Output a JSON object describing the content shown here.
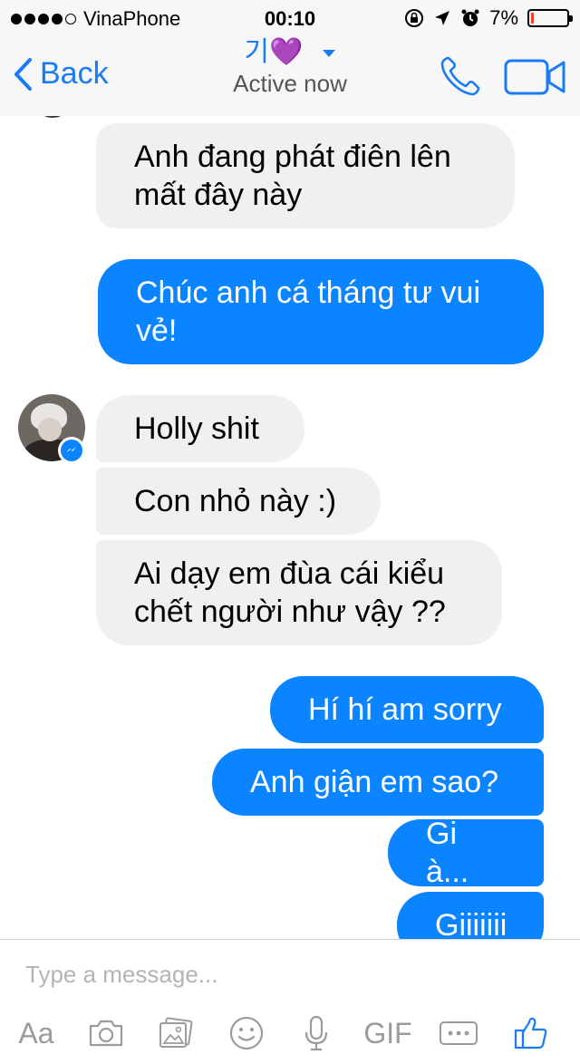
{
  "status_bar": {
    "carrier": "VinaPhone",
    "time": "00:10",
    "battery_text": "7%",
    "battery_level": 0.07,
    "battery_color": "#ff3b30"
  },
  "header": {
    "back_label": "Back",
    "contact_name": "기💜",
    "presence": "Active now",
    "accent": "#1a7cf5"
  },
  "messages": [
    {
      "side": "in",
      "text_lines": [
        "Anh đang phát điên lên",
        "mất đây này"
      ]
    },
    {
      "side": "out",
      "text_lines": [
        "Chúc anh cá tháng tư vui",
        "vẻ!"
      ]
    },
    {
      "side": "in",
      "text_lines": [
        "Holly shit"
      ]
    },
    {
      "side": "in",
      "text_lines": [
        "Con nhỏ này :)"
      ]
    },
    {
      "side": "in",
      "text_lines": [
        "Ai dạy em đùa cái kiểu",
        "chết người như vậy ??"
      ]
    },
    {
      "side": "out",
      "text_lines": [
        "Hí hí am sorry"
      ]
    },
    {
      "side": "out",
      "text_lines": [
        "Anh giận em sao?"
      ]
    },
    {
      "side": "out",
      "text_lines": [
        "Gi à..."
      ]
    },
    {
      "side": "out",
      "text_lines": [
        "Giiiiiii"
      ]
    }
  ],
  "composer": {
    "placeholder": "Type a message...",
    "tools": [
      "Aa",
      "camera-icon",
      "gallery-icon",
      "emoji-icon",
      "microphone-icon",
      "GIF",
      "more-icon",
      "thumbs-up-icon"
    ]
  },
  "colors": {
    "outgoing_bubble": "#0a84ff",
    "incoming_bubble": "#f1f0f0"
  }
}
